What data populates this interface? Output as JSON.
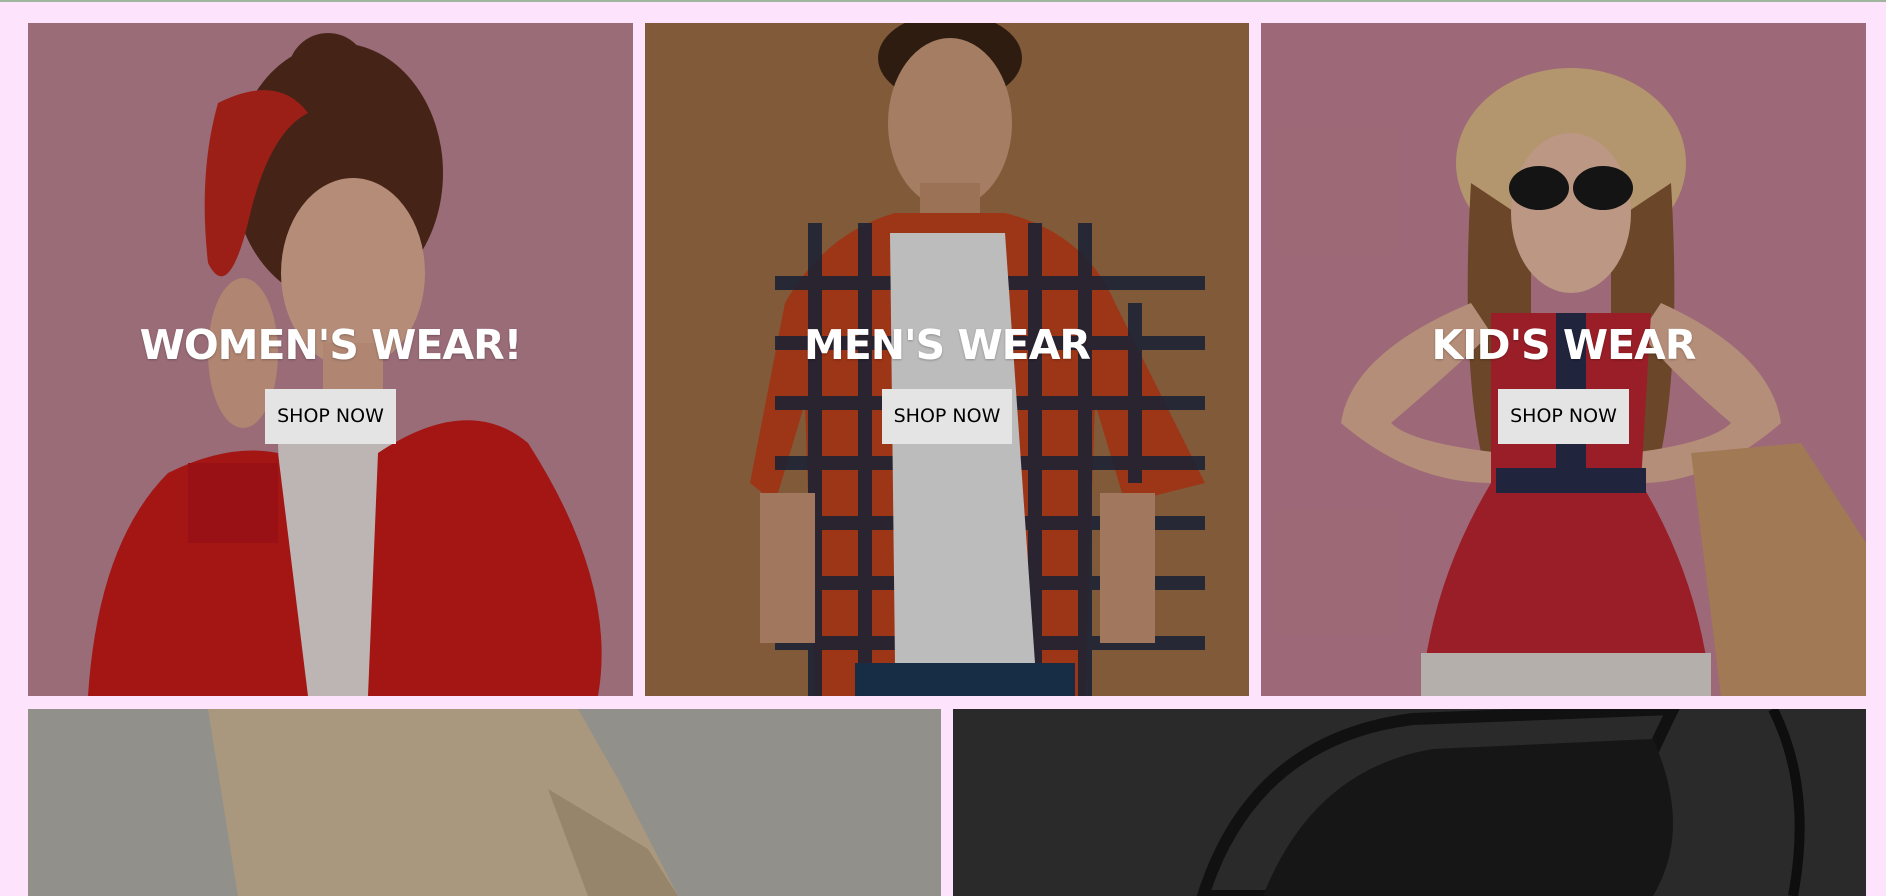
{
  "categories": [
    {
      "title": "WOMEN'S WEAR!",
      "button_label": "SHOP NOW",
      "bg_color": "#c48b9a"
    },
    {
      "title": "MEN'S WEAR",
      "button_label": "SHOP NOW",
      "bg_color": "#a67549"
    },
    {
      "title": "KID'S WEAR",
      "button_label": "SHOP NOW",
      "bg_color": "#c98699"
    }
  ],
  "secondary_cards": [
    {
      "bg_color": "#9a9892"
    },
    {
      "bg_color": "#2a2a2a"
    }
  ],
  "colors": {
    "page_background": "#fde3fb",
    "button_background": "#e4e4e4",
    "title_text": "#ffffff"
  }
}
